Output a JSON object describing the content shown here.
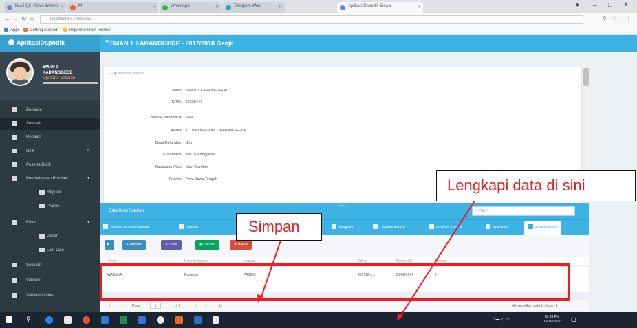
{
  "browser": {
    "tabs": [
      {
        "label": "Hasil Q3_Kirain Internet"
      },
      {
        "label": "M"
      },
      {
        "label": "WhatsApp"
      },
      {
        "label": "Telegram Web"
      },
      {
        "label": "Aplikasi Dapodik Siswa"
      }
    ],
    "url": "localhost:5774/#/siswa",
    "bookmarks": [
      "Apps",
      "Getting Started",
      "Imported From Firefox"
    ]
  },
  "header": {
    "brand": "AplikasiDapodik",
    "title": "SMAN 1 KARANGGEDE - 2017/2018 Genjil"
  },
  "user": {
    "name_line1": "SMAN 1",
    "name_line2": "KARANGGEDE",
    "role": "Operator Sekolah"
  },
  "sidebar": {
    "items": [
      {
        "label": "Beranda"
      },
      {
        "label": "Sekolah"
      },
      {
        "label": "Rombel"
      },
      {
        "label": "GTK"
      },
      {
        "label": "Peserta Didik"
      },
      {
        "label": "Pembelajaran Rombel"
      },
      {
        "label": "Reguler"
      },
      {
        "label": "Praktik"
      },
      {
        "label": "Kirim"
      },
      {
        "label": "Pesan"
      },
      {
        "label": "Lain-Lain"
      },
      {
        "label": "Sekolah"
      },
      {
        "label": "Validasi"
      },
      {
        "label": "Validasi Online"
      }
    ]
  },
  "panel": {
    "header": "Identitas Sekolah",
    "fields": [
      {
        "key": "Nama",
        "value": "SMAN 1 KARANGGEDE"
      },
      {
        "key": "NPSN",
        "value": "20328447"
      },
      {
        "key": "Bentuk Pendidikan",
        "value": "SMA"
      },
      {
        "key": "Alamat",
        "value": "JL. DIPONEGORO, KARANGGEDE"
      },
      {
        "key": "Desa/Kelurahan",
        "value": "Sruri"
      },
      {
        "key": "Kecamatan",
        "value": "Kec. Karanggede"
      },
      {
        "key": "Kabupaten/Kota",
        "value": "Kab. Boyolali"
      },
      {
        "key": "Provinsi",
        "value": "Prov. Jawa Tengah"
      }
    ]
  },
  "data_panel": {
    "title": "Data Rinci Sekolah",
    "select_placeholder": "-- Pilih --",
    "tabs": [
      "Jumlah Diff Data Sekolah",
      "Sanitasi",
      "Blokgrant",
      "Layanan Khusus",
      "Program Khusus",
      "Akreditasi",
      "Kesejahteraan"
    ],
    "buttons": [
      "Tambah",
      "Ubah",
      "Simpan",
      "Hapus"
    ],
    "columns": [
      "Jenis",
      "Penyelenggara",
      "Instansi",
      "Tahun",
      "Nomor SK",
      "Jumlah"
    ],
    "row": [
      "WAKABA",
      "Pusatora",
      "PASKIB",
      "005712 / ...",
      "01/08/2017",
      "2"
    ],
    "pager": {
      "left": "Page",
      "page": "1",
      "of": "of 1",
      "right": "Menampilkan data 1 - 1 dari 1"
    }
  },
  "taskbar": {
    "time": "03:23 PM",
    "date": "19/10/2017"
  },
  "annotations": {
    "simpan": "Simpan",
    "lengkapi": "Lengkapi data di sini"
  },
  "colors": {
    "accent": "#3cb3e4",
    "sidebar": "#2d3a42",
    "annotation_red": "#ef1c23"
  }
}
